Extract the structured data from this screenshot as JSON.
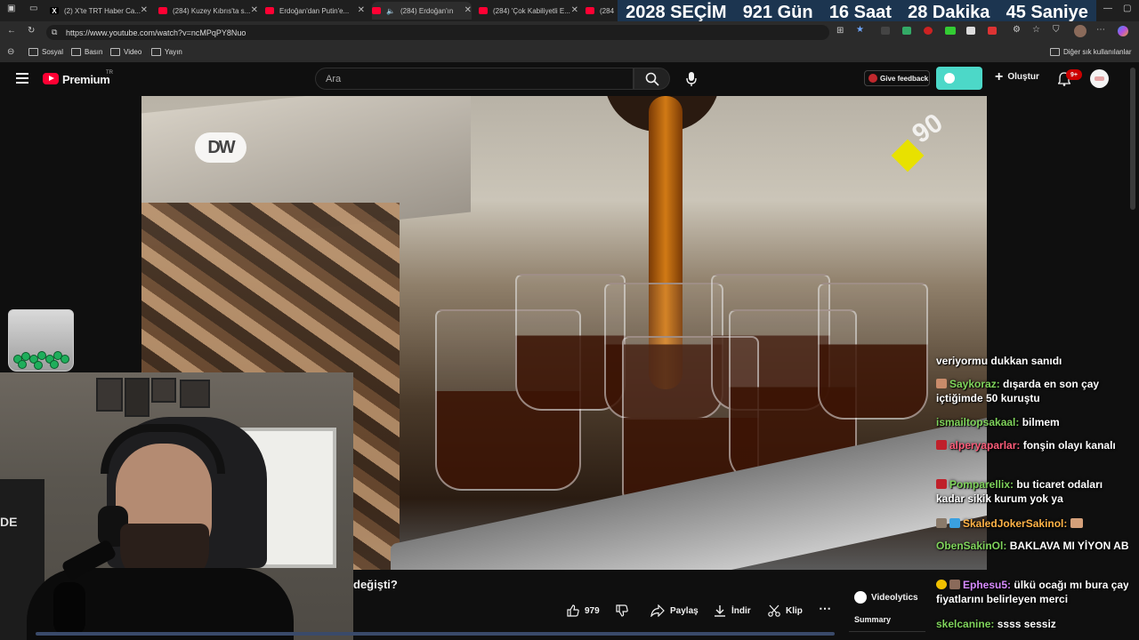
{
  "tabs": [
    {
      "title": "(2) X'te TRT Haber Ca...",
      "icon": "x-logo-icon"
    },
    {
      "title": "(284) Kuzey Kıbrıs'ta s...",
      "icon": "youtube-icon"
    },
    {
      "title": "Erdoğan'dan Putin'e...",
      "icon": "youtube-icon"
    },
    {
      "title": "(284) Erdoğan'ın",
      "icon": "youtube-icon",
      "audio": true
    },
    {
      "title": "(284) 'Çok Kabiliyetli E...",
      "icon": "youtube-icon"
    },
    {
      "title": "(284",
      "icon": "youtube-icon"
    }
  ],
  "countdown": {
    "label": "2028 SEÇİM",
    "days": "921 Gün",
    "hours": "16 Saat",
    "minutes": "28 Dakika",
    "seconds": "45 Saniye",
    "bg": "#1c3550"
  },
  "browser": {
    "url": "https://www.youtube.com/watch?v=ncMPqPY8Nuo",
    "bookmarks": [
      "Sosyal",
      "Basın",
      "Video",
      "Yayın"
    ],
    "other_bookmarks": "Diğer sık kullanılanlar"
  },
  "youtube": {
    "logo": "Premium",
    "region": "TR",
    "search_placeholder": "Ara",
    "feedback": "Give feedback",
    "create": "Oluştur",
    "notif_count": "9+",
    "accent": "#ff0033"
  },
  "video": {
    "watermark": "DW",
    "badge": "90"
  },
  "below": {
    "title_fragment": "değişti?",
    "likes": "979",
    "share": "Paylaş",
    "download": "İndir",
    "clip": "Klip",
    "videolytics": "Videolytics",
    "summary": "Summary"
  },
  "chat": [
    {
      "user": "",
      "text": "veriyormu dukkan sanıdı",
      "color": "#ffffff"
    },
    {
      "user": "Saykoraz:",
      "text": "dışarda en son çay içtiğimde 50 kuruştu",
      "color": "#7fd35b"
    },
    {
      "user": "ismailtopsakaal:",
      "text": "bilmem",
      "color": "#7fd35b"
    },
    {
      "user": "alperyaparlar:",
      "text": "fonşin olayı kanalı",
      "color": "#ff5d7a"
    },
    {
      "user": "Pomparellix:",
      "text": "bu ticaret odaları kadar sikik kurum yok ya",
      "color": "#7fd35b"
    },
    {
      "user": "SkaledJokerSakinol:",
      "text": "",
      "color": "#ffb347"
    },
    {
      "user": "ObenSakinOl:",
      "text": "BAKLAVA MI YİYON ABİ",
      "color": "#7fd35b"
    },
    {
      "user": "Ephesu5:",
      "text": "ülkü ocağı mı bura çay fiyatlarını belirleyen merci",
      "color": "#d78bff"
    },
    {
      "user": "skelcanine:",
      "text": "ssss sessiz",
      "color": "#7fd35b"
    }
  ]
}
